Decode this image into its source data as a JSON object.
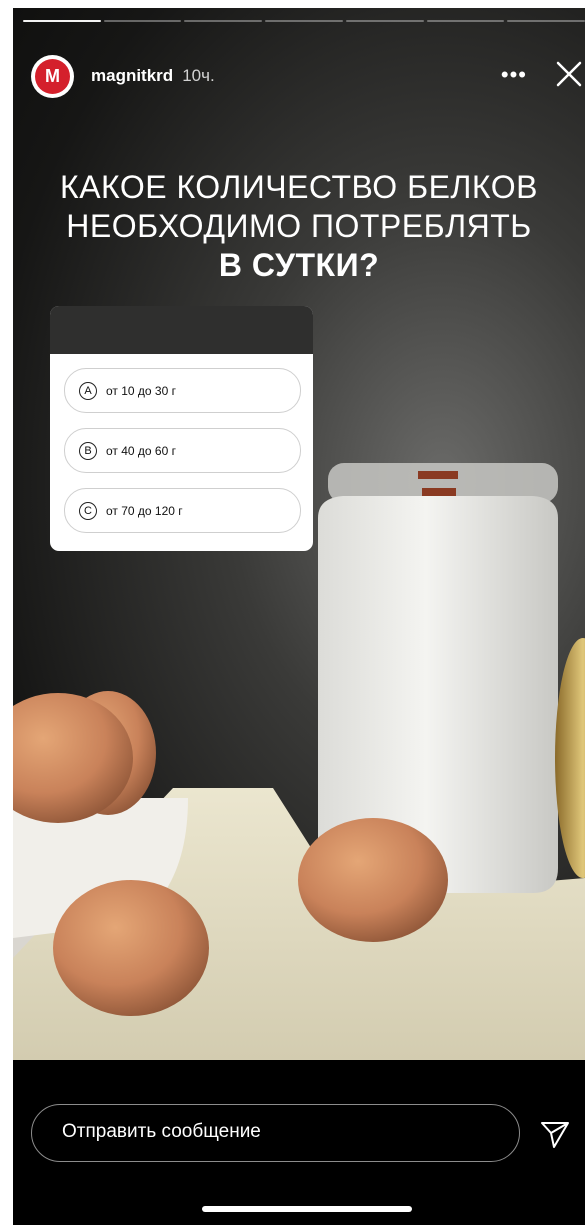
{
  "story": {
    "progress_segments": 7,
    "active_segment": 1,
    "username": "magnitkrd",
    "time": "10ч.",
    "avatar_letter": "М",
    "more_icon": "more-dots-icon",
    "close_icon": "close-icon"
  },
  "question": {
    "line1": "КАКОЕ КОЛИЧЕСТВО БЕЛКОВ",
    "line2": "НЕОБХОДИМО ПОТРЕБЛЯТЬ",
    "line3": "В СУТКИ?"
  },
  "quiz": {
    "options": [
      {
        "letter": "A",
        "text": "от 10 до 30 г"
      },
      {
        "letter": "B",
        "text": "от 40 до 60 г"
      },
      {
        "letter": "C",
        "text": "от 70 до 120 г"
      }
    ]
  },
  "composer": {
    "placeholder": "Отправить сообщение"
  },
  "colors": {
    "brand": "#d4202c",
    "background": "#000000"
  }
}
